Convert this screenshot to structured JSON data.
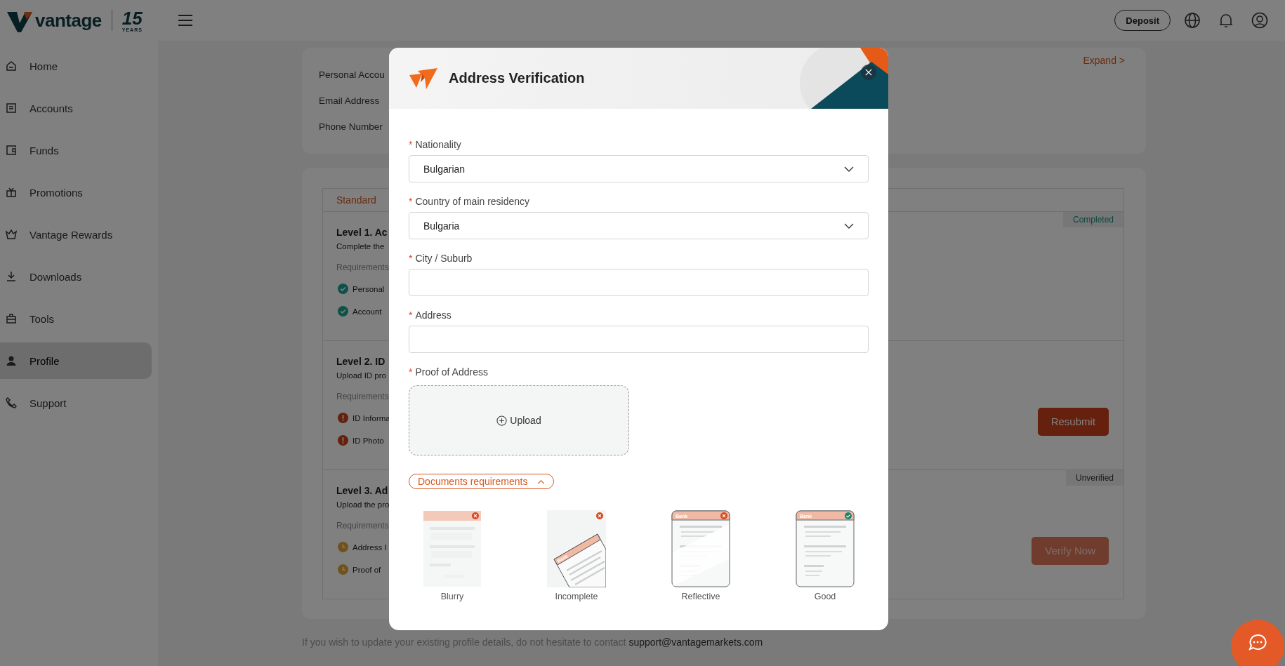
{
  "header": {
    "logo": "vantage",
    "anniversary": "15",
    "anniversary_caption": "YEARS",
    "deposit": "Deposit"
  },
  "sidebar": {
    "items": [
      {
        "label": "Home",
        "selected": false
      },
      {
        "label": "Accounts",
        "selected": false
      },
      {
        "label": "Funds",
        "selected": false
      },
      {
        "label": "Promotions",
        "selected": false
      },
      {
        "label": "Vantage Rewards",
        "selected": false
      },
      {
        "label": "Downloads",
        "selected": false
      },
      {
        "label": "Tools",
        "selected": false
      },
      {
        "label": "Profile",
        "selected": true
      },
      {
        "label": "Support",
        "selected": false
      }
    ]
  },
  "profile_card": {
    "rows": [
      "Personal Accou",
      "Email Address",
      "Phone Number"
    ],
    "expand": "Expand >"
  },
  "verification": {
    "tab": "Standard",
    "levels": [
      {
        "title": "Level 1. Ac",
        "description": "Complete the",
        "requirements_label": "Requirements",
        "requirements": [
          {
            "text": "Personal",
            "kind": "done"
          },
          {
            "text": "Account",
            "kind": "done"
          }
        ],
        "badge": {
          "text": "Completed",
          "kind": "completed"
        }
      },
      {
        "title": "Level 2. ID",
        "description": "Upload ID pro",
        "requirements_label": "Requirements",
        "requirements": [
          {
            "text": "ID Informa",
            "kind": "failed"
          },
          {
            "text": "ID Photo",
            "kind": "failed"
          }
        ],
        "button": {
          "label": "Resubmit",
          "disabled": false
        }
      },
      {
        "title": "Level 3. Ad",
        "description": "Upload the pro",
        "requirements_label": "Requirements",
        "requirements": [
          {
            "text": "Address I",
            "kind": "pending"
          },
          {
            "text": "Proof of",
            "kind": "pending"
          }
        ],
        "badge": {
          "text": "Unverified",
          "kind": "unverified"
        },
        "button": {
          "label": "Verify Now",
          "disabled": true
        }
      }
    ]
  },
  "footer": {
    "note": "If you wish to update your existing profile details, do not hesitate to contact",
    "email": "support@vantagemarkets.com"
  },
  "modal": {
    "title": "Address Verification",
    "fields": [
      {
        "mark": "*",
        "label": "Nationality",
        "kind": "select",
        "value": "Bulgarian"
      },
      {
        "mark": "*",
        "label": "Country of main residency",
        "kind": "select",
        "value": "Bulgaria"
      },
      {
        "mark": "*",
        "label": "City / Suburb",
        "kind": "text"
      },
      {
        "mark": "*",
        "label": "Address",
        "kind": "text"
      },
      {
        "mark": "*",
        "label": "Proof of Address",
        "kind": "upload",
        "button": "Upload"
      }
    ],
    "requirements_toggle": {
      "label": "Documents requirements",
      "expanded": true
    },
    "examples": [
      {
        "kind": "blurry",
        "label": "Blurry",
        "acceptable": false
      },
      {
        "kind": "incomplete",
        "label": "Incomplete",
        "acceptable": false,
        "header": "Bank"
      },
      {
        "kind": "reflective",
        "label": "Reflective",
        "acceptable": false,
        "header": "Bank"
      },
      {
        "kind": "good",
        "label": "Good",
        "acceptable": true,
        "header": "Bank"
      }
    ]
  }
}
